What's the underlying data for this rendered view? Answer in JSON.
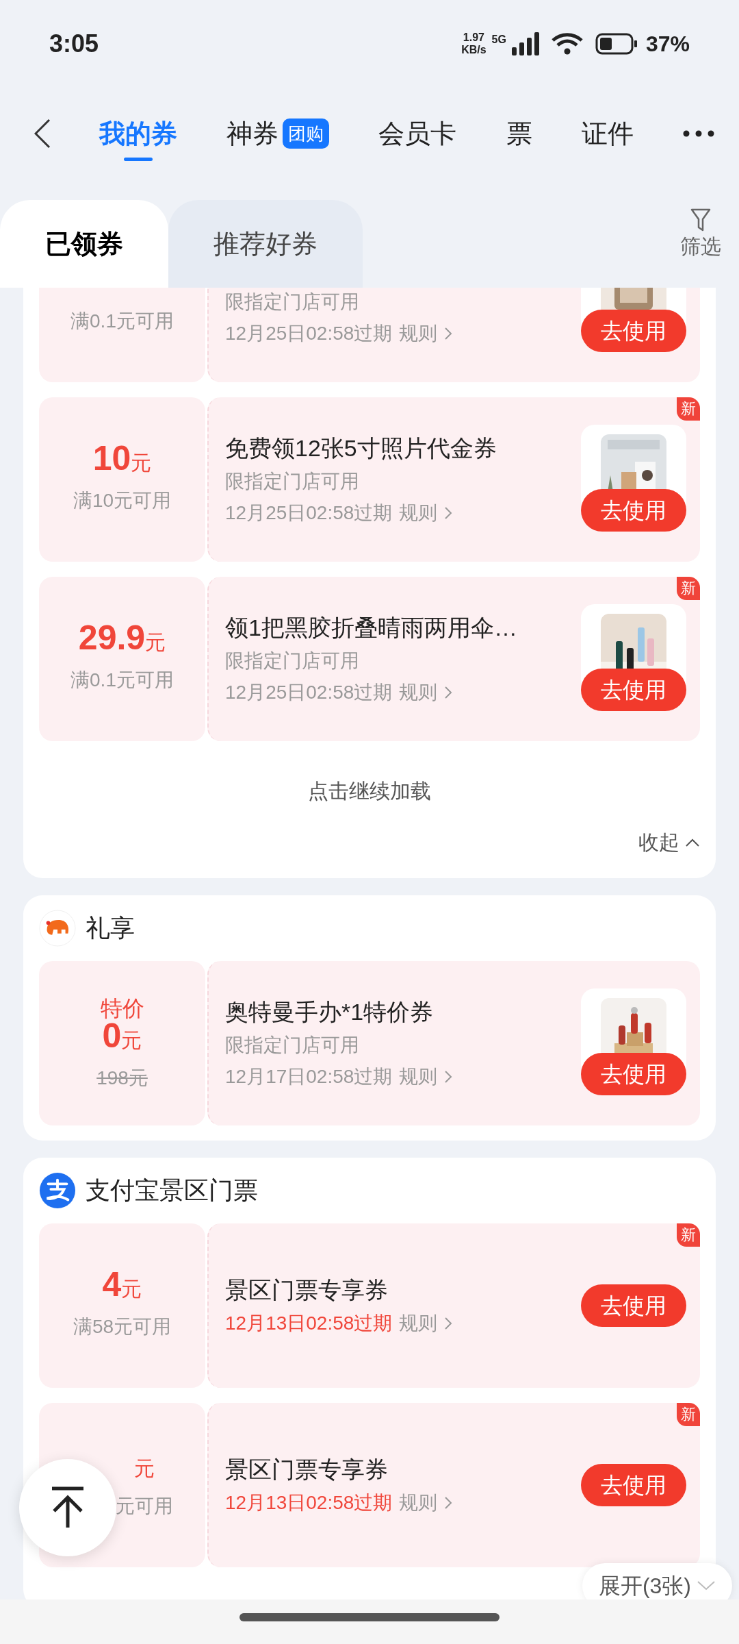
{
  "status_bar": {
    "time": "3:05",
    "speed": "1.97",
    "speed_unit": "KB/s",
    "network": "5G",
    "battery": "37%"
  },
  "nav_tabs": [
    {
      "label": "我的券",
      "selected": true
    },
    {
      "label": "神券",
      "badge": "团购",
      "selected": false
    },
    {
      "label": "会员卡",
      "selected": false
    },
    {
      "label": "票",
      "selected": false
    },
    {
      "label": "证件",
      "selected": false
    }
  ],
  "sub_tabs": [
    {
      "label": "已领券",
      "selected": true
    },
    {
      "label": "推荐好券",
      "selected": false
    }
  ],
  "filter": {
    "label": "筛选"
  },
  "sections": [
    {
      "coupons": [
        {
          "condition": "满0.1元可用",
          "scope": "限指定门店可用",
          "expiry": "12月25日02:58过期",
          "expiry_urgent": false,
          "rules": "规则",
          "button": "去使用",
          "new": false
        },
        {
          "amount": "10",
          "unit": "元",
          "condition": "满10元可用",
          "title": "免费领12张5寸照片代金券",
          "scope": "限指定门店可用",
          "expiry": "12月25日02:58过期",
          "expiry_urgent": false,
          "rules": "规则",
          "button": "去使用",
          "new": true,
          "new_label": "新"
        },
        {
          "amount": "29.9",
          "unit": "元",
          "condition": "满0.1元可用",
          "title": "领1把黑胶折叠晴雨两用伞…",
          "scope": "限指定门店可用",
          "expiry": "12月25日02:58过期",
          "expiry_urgent": false,
          "rules": "规则",
          "button": "去使用",
          "new": true,
          "new_label": "新"
        }
      ],
      "load_more": "点击继续加载",
      "collapse": "收起"
    },
    {
      "title": "礼享",
      "kind": "elephant",
      "coupons": [
        {
          "label": "特价",
          "amount": "0",
          "unit": "元",
          "original_price": "198元",
          "title": "奥特曼手办*1特价券",
          "scope": "限指定门店可用",
          "expiry": "12月17日02:58过期",
          "expiry_urgent": false,
          "rules": "规则",
          "button": "去使用",
          "new": false
        }
      ]
    },
    {
      "title": "支付宝景区门票",
      "kind": "alipay",
      "coupons": [
        {
          "amount": "4",
          "unit": "元",
          "condition": "满58元可用",
          "title": "景区门票专享券",
          "expiry": "12月13日02:58过期",
          "expiry_urgent": true,
          "rules": "规则",
          "button": "去使用",
          "new": true,
          "new_label": "新"
        },
        {
          "unit": "元",
          "condition": "元可用",
          "title": "景区门票专享券",
          "expiry": "12月13日02:58过期",
          "expiry_urgent": true,
          "rules": "规则",
          "button": "去使用",
          "new": true,
          "new_label": "新"
        }
      ],
      "expand": "展开(3张)"
    }
  ]
}
